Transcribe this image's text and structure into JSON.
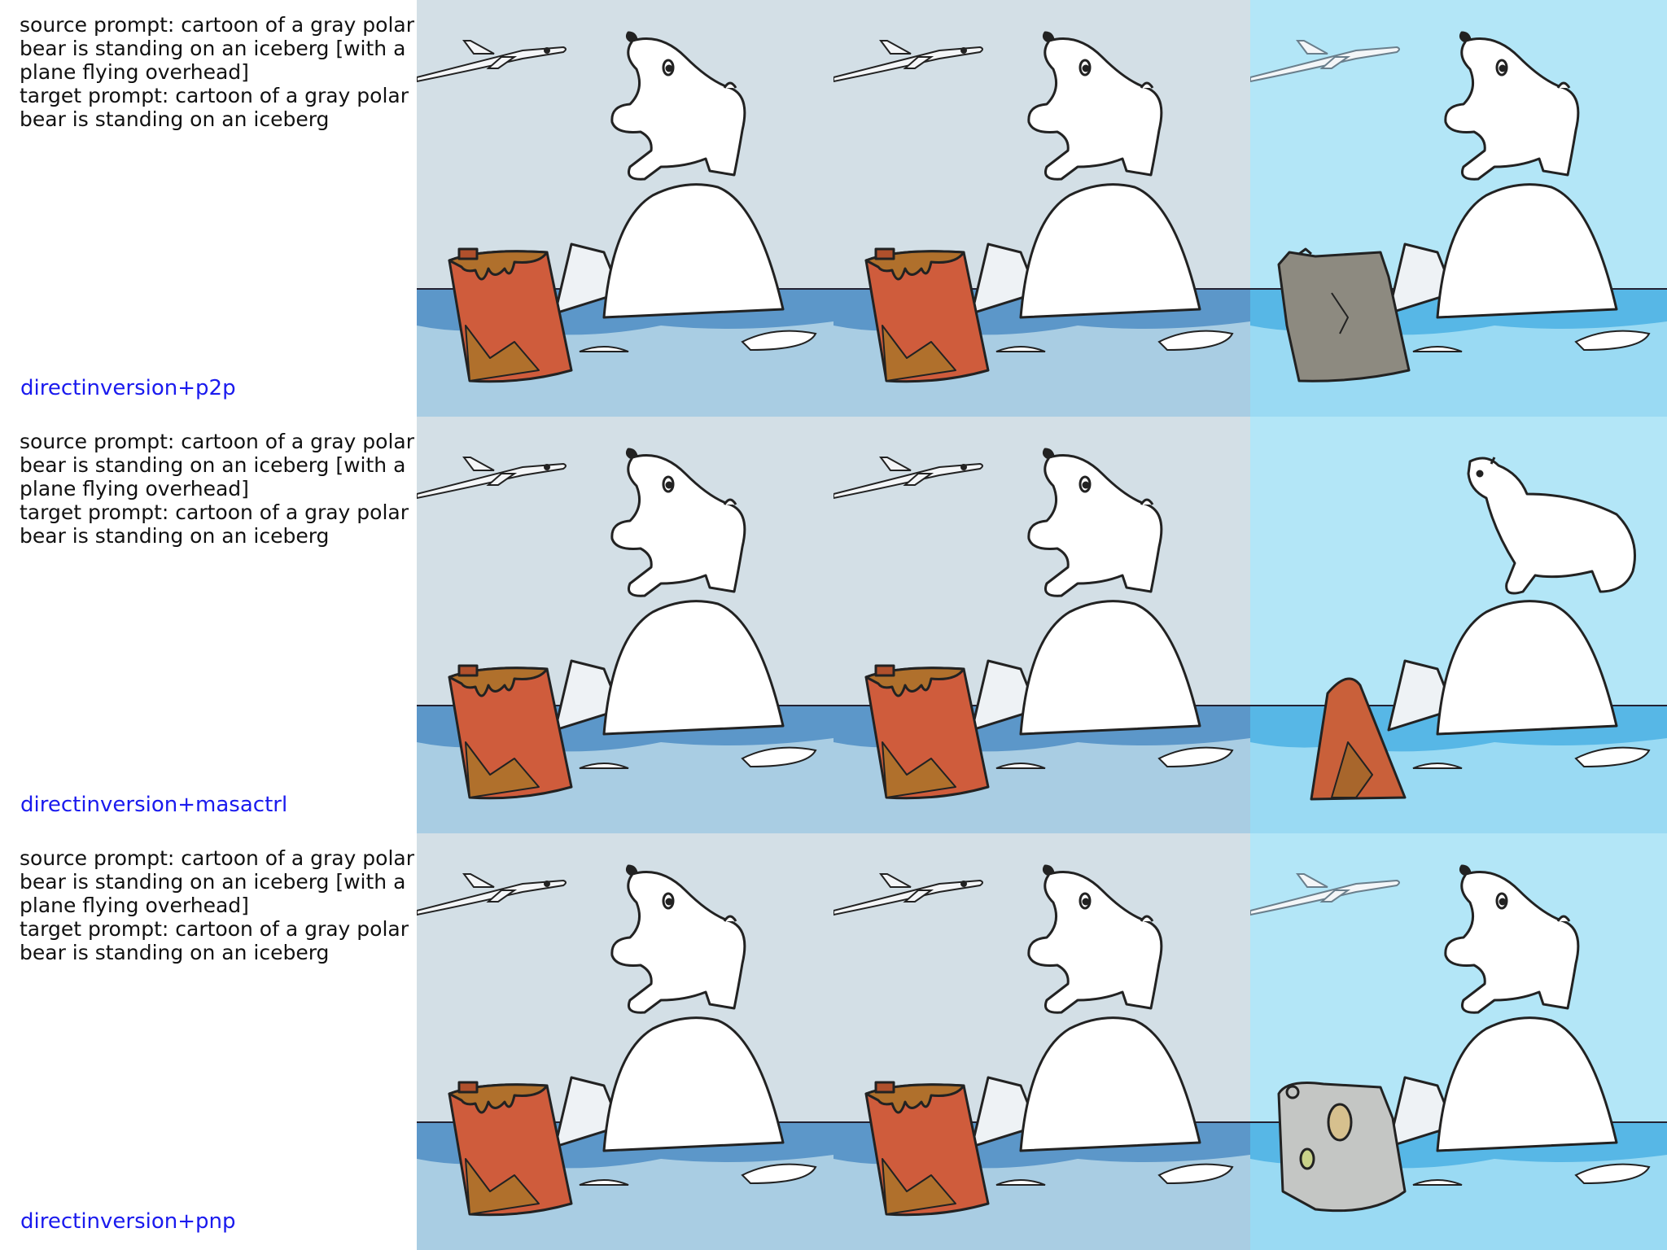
{
  "rows": [
    {
      "source_prompt": "source prompt: cartoon of a gray polar bear is standing on an iceberg [with a plane flying overhead]",
      "target_prompt": "target prompt: cartoon of a gray polar bear is standing on an iceberg",
      "method": "directinversion+p2p"
    },
    {
      "source_prompt": "source prompt: cartoon of a gray polar bear is standing on an iceberg [with a plane flying overhead]",
      "target_prompt": "target prompt: cartoon of a gray polar bear is standing on an iceberg",
      "method": "directinversion+masactrl"
    },
    {
      "source_prompt": "source prompt: cartoon of a gray polar bear is standing on an iceberg [with a plane flying overhead]",
      "target_prompt": "target prompt: cartoon of a gray polar bear is standing on an iceberg",
      "method": "directinversion+pnp"
    }
  ],
  "colors": {
    "sky_original": "#d3dfe6",
    "sky_edited": "#b3e6f7",
    "water": "#5c97c9",
    "water_light": "#a9cde3",
    "iceberg": "#ffffff",
    "barrel": "#cf5c3c",
    "rock": "#8d8a80",
    "method_label": "#1a1aee"
  },
  "panels": [
    "source-image",
    "reconstructed-image",
    "edited-image"
  ]
}
